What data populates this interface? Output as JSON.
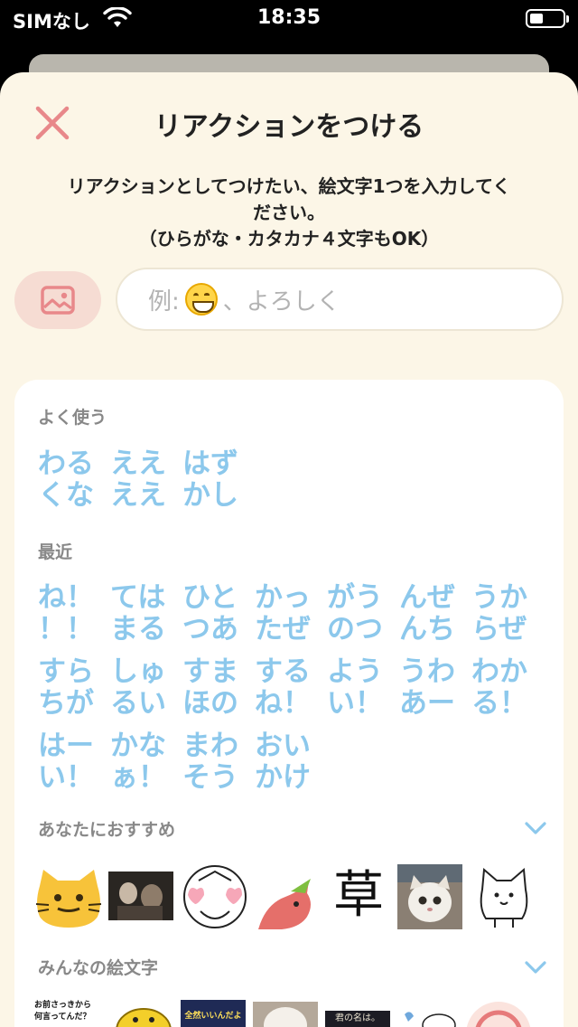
{
  "status_bar": {
    "carrier": "SIMなし",
    "time": "18:35"
  },
  "sheet": {
    "title": "リアクションをつける",
    "instructions_line1": "リアクションとしてつけたい、絵文字1つを入力してく",
    "instructions_line2": "ださい。",
    "instructions_line3": "（ひらがな・カタカナ４文字もOK）",
    "input": {
      "placeholder_prefix": "例:",
      "placeholder_suffix": "、よろしく",
      "value": ""
    }
  },
  "frequently_used": {
    "label": "よく使う",
    "items": [
      {
        "top": "わる",
        "bottom": "くな"
      },
      {
        "top": "ええ",
        "bottom": "ええ"
      },
      {
        "top": "はず",
        "bottom": "かし"
      }
    ]
  },
  "recent": {
    "label": "最近",
    "items": [
      {
        "top": "ね！",
        "bottom": "！！"
      },
      {
        "top": "ては",
        "bottom": "まる"
      },
      {
        "top": "ひと",
        "bottom": "つあ"
      },
      {
        "top": "かっ",
        "bottom": "たぜ"
      },
      {
        "top": "がう",
        "bottom": "のつ"
      },
      {
        "top": "んぜ",
        "bottom": "んち"
      },
      {
        "top": "うか",
        "bottom": "らぜ"
      },
      {
        "top": "すら",
        "bottom": "ちが"
      },
      {
        "top": "しゅ",
        "bottom": "るい"
      },
      {
        "top": "すま",
        "bottom": "ほの"
      },
      {
        "top": "する",
        "bottom": "ね！"
      },
      {
        "top": "よう",
        "bottom": "い！"
      },
      {
        "top": "うわ",
        "bottom": "あー"
      },
      {
        "top": "わか",
        "bottom": "る！"
      },
      {
        "top": "はー",
        "bottom": "い！"
      },
      {
        "top": "かな",
        "bottom": "ぁ！"
      },
      {
        "top": "まわ",
        "bottom": "そう"
      },
      {
        "top": "おい",
        "bottom": "かけ"
      }
    ]
  },
  "recommended": {
    "label": "あなたにおすすめ",
    "stickers": [
      "cat-face-icon",
      "photo-sticker",
      "heart-hands-sticker",
      "bird-sticker",
      "kusa-sticker",
      "cat-photo-sticker",
      "cat-drawing-sticker"
    ],
    "kusa_text": "草"
  },
  "everyone": {
    "label": "みんなの絵文字",
    "stickers": [
      "text-sticker-1",
      "yellow-face-sticker",
      "text-sticker-2",
      "dog-photo-sticker",
      "text-sticker-3",
      "doodle-sticker",
      "prohibit-sticker"
    ],
    "sticker_texts": [
      "お前さっきから",
      "何言ってんだ？",
      "全然いいんだよ",
      "君の名は。"
    ]
  },
  "colors": {
    "sheet_bg": "#fcf6e7",
    "reaction_text": "#8cc8ec",
    "close_icon": "#e8888a",
    "chevron": "#8cc8ec"
  }
}
